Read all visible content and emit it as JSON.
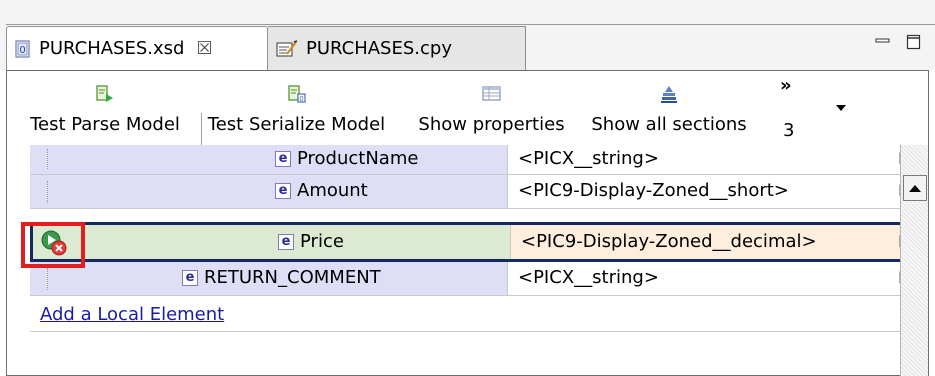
{
  "tabs": [
    {
      "label": "PURCHASES.xsd",
      "icon": "xsd-file-icon",
      "close": "☒"
    },
    {
      "label": "PURCHASES.cpy",
      "icon": "copybook-file-icon"
    }
  ],
  "window_controls": {
    "minimize": "minimize-icon",
    "maximize": "maximize-icon"
  },
  "toolbar": {
    "buttons": [
      {
        "label": "Test Parse Model",
        "icon": "test-parse-icon"
      },
      {
        "label": "Test Serialize Model",
        "icon": "test-serialize-icon"
      },
      {
        "label": "Show properties",
        "icon": "properties-table-icon"
      },
      {
        "label": "Show all sections",
        "icon": "sections-stack-icon"
      }
    ],
    "overflow": {
      "chevron": "»",
      "count": "3"
    }
  },
  "elements": [
    {
      "badge": "e",
      "name": "ProductName",
      "type": "<PICX__string>",
      "trunc": "I"
    },
    {
      "badge": "e",
      "name": "Amount",
      "type": "<PIC9-Display-Zoned__short>",
      "trunc": "I"
    },
    {
      "badge": "e",
      "name": "Price",
      "type": "<PIC9-Display-Zoned__decimal>",
      "trunc": "I",
      "selected": true,
      "status_icon": "run-error-icon"
    },
    {
      "badge": "e",
      "name": "RETURN_COMMENT",
      "type": "<PICX__string>",
      "trunc": "I"
    }
  ],
  "add_link": "Add a Local Element",
  "colors": {
    "name_cell": "#dedff7",
    "selected_name": "#dcead2",
    "selected_type": "#fdeedd",
    "selection_border": "#17285e",
    "highlight_box": "#e41e1e",
    "link": "#1a1aa8"
  }
}
